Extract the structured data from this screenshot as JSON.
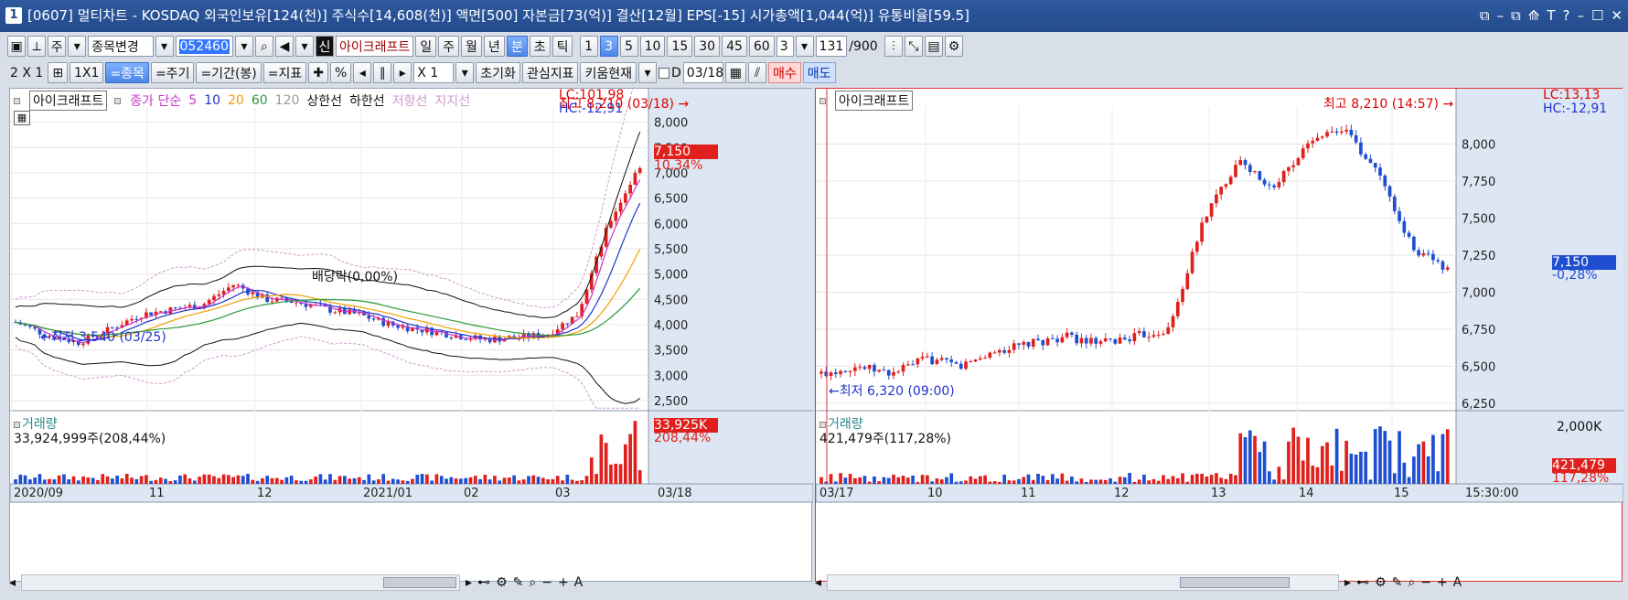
{
  "window": {
    "number": "1",
    "title": "[0607] 멀티차트 - KOSDAQ 외국인보유[124(천)] 주식수[14,608(천)] 액면[500] 자본금[73(억)] 결산[12월] EPS[-15] 시가총액[1,044(억)] 유통비율[59.5]",
    "buttons": [
      "⧉",
      "–",
      "⧉",
      "⟰",
      "T",
      "?",
      "–",
      "☐",
      "✕"
    ]
  },
  "toolbar1": {
    "market": "주",
    "change_symbol": "종목변경",
    "code": "052460",
    "stock_badge": "신",
    "stock_name": "아이크래프트",
    "periods": [
      "일",
      "주",
      "월",
      "년",
      "분",
      "초",
      "틱"
    ],
    "active_period": "분",
    "minutes": [
      "1",
      "3",
      "5",
      "10",
      "15",
      "30",
      "45",
      "60"
    ],
    "active_minute": "3",
    "interval": "3",
    "count": "131",
    "count_max": "/900"
  },
  "toolbar2": {
    "layout": "2 X 1",
    "layout_single": "1X1",
    "tabs": [
      "=종목",
      "=주기",
      "=기간(봉)",
      "=지표"
    ],
    "active_tab": "=종목",
    "percent": "%",
    "multiplier": "X 1",
    "reset": "초기화",
    "interest": "관심지표",
    "kiwoom": "키움현재",
    "d_label": "D",
    "date": "03/18",
    "buy": "매수",
    "sell": "매도"
  },
  "left": {
    "stock_name": "아이크래프트",
    "legend_close": "종가 단순",
    "ma": [
      "5",
      "10",
      "20",
      "60",
      "120"
    ],
    "legend_upper": "상한선",
    "legend_lower": "하한선",
    "legend_resist": "저항선",
    "legend_support": "지지선",
    "lc": "LC:101,98",
    "hc": "HC:-12,91",
    "high": "최고 8,210 (03/18) →",
    "low": "←최저 3,540 (03/25)",
    "dividend": "배당락(0,00%)",
    "price": "7,150",
    "change": "10,34%",
    "vol_title": "거래량",
    "vol_text": "33,924,999주(208,44%)",
    "vol_badge": "33,925K",
    "vol_pct": "208,44%",
    "price_axis": [
      "8,000",
      "7,500",
      "7,000",
      "6,500",
      "6,000",
      "5,500",
      "5,000",
      "4,500",
      "4,000",
      "3,500",
      "3,000",
      "2,500"
    ],
    "date_axis": [
      "2020/09",
      "11",
      "12",
      "2021/01",
      "02",
      "03",
      "03/18"
    ]
  },
  "right": {
    "stock_name": "아이크래프트",
    "lc": "LC:13,13",
    "hc": "HC:-12,91",
    "high": "최고 8,210 (14:57) →",
    "low": "←최저 6,320 (09:00)",
    "price": "7,150",
    "change": "-0,28%",
    "vol_title": "거래량",
    "vol_text": "421,479주(117,28%)",
    "vol_badge": "421,479",
    "vol_pct": "117,28%",
    "vol_axis": "2,000K",
    "price_axis": [
      "8,000",
      "7,750",
      "7,500",
      "7,250",
      "7,000",
      "6,750",
      "6,500",
      "6,250"
    ],
    "date_axis": [
      "03/17",
      "10",
      "11",
      "12",
      "13",
      "14",
      "15",
      "15:30:00"
    ]
  },
  "colors": {
    "up": "#e0201d",
    "down": "#1f4fd0",
    "title": "#2a52a0",
    "ma5": "#cc33cc",
    "ma10": "#2233cc",
    "ma20": "#f0a000",
    "ma60": "#2a9a3a",
    "ma120": "#999999"
  },
  "chart_data": [
    {
      "type": "candlestick",
      "title": "아이크래프트 (일)",
      "ylim": [
        2300,
        8300
      ],
      "categories": [
        "2020/09",
        "11",
        "12",
        "2021/01",
        "02",
        "03"
      ],
      "series": [
        {
          "name": "종가",
          "values": [
            4050,
            3800,
            3650,
            3900,
            4200,
            4300,
            4400,
            4800,
            4500,
            4450,
            4300,
            4200,
            4000,
            3900,
            3800,
            3700,
            3750,
            3800,
            4200,
            6000,
            7150
          ]
        }
      ],
      "high": 8210,
      "low": 3540
    },
    {
      "type": "candlestick",
      "title": "아이크래프트 (3분)",
      "ylim": [
        6200,
        8250
      ],
      "categories": [
        "03/17",
        "10",
        "11",
        "12",
        "13",
        "14",
        "15"
      ],
      "series": [
        {
          "name": "종가",
          "values": [
            6450,
            6500,
            6450,
            6550,
            6500,
            6600,
            6650,
            6700,
            6650,
            6700,
            6750,
            7500,
            7900,
            7700,
            8000,
            8100,
            7800,
            7300,
            7150
          ]
        }
      ],
      "high": 8210,
      "low": 6320
    }
  ]
}
